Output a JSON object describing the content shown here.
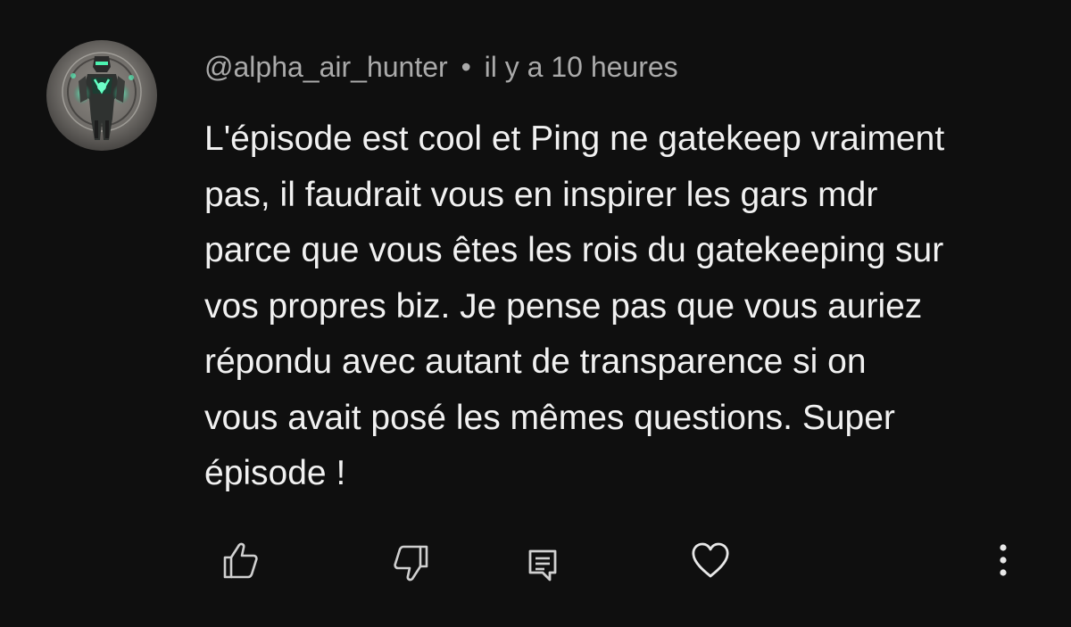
{
  "comment": {
    "author": "@alpha_air_hunter",
    "separator": "•",
    "timestamp": "il y a 10 heures",
    "text_lines": [
      "L'épisode est cool et Ping ne gatekeep vraiment",
      "pas, il faudrait vous en inspirer les gars mdr",
      "parce que vous êtes les rois du gatekeeping sur",
      "vos propres biz. Je pense pas que vous auriez",
      "répondu avec autant de transparence si on",
      "vous avait posé les mêmes questions. Super",
      "épisode !"
    ]
  },
  "actions": {
    "like_icon": "thumbs-up-icon",
    "dislike_icon": "thumbs-down-icon",
    "reply_icon": "reply-comment-icon",
    "heart_icon": "heart-icon",
    "more_icon": "more-vertical-icon"
  },
  "colors": {
    "background": "#0f0f0f",
    "text_primary": "#f1f1f1",
    "text_secondary": "#aaaaaa",
    "icon": "#d0d0d0"
  }
}
